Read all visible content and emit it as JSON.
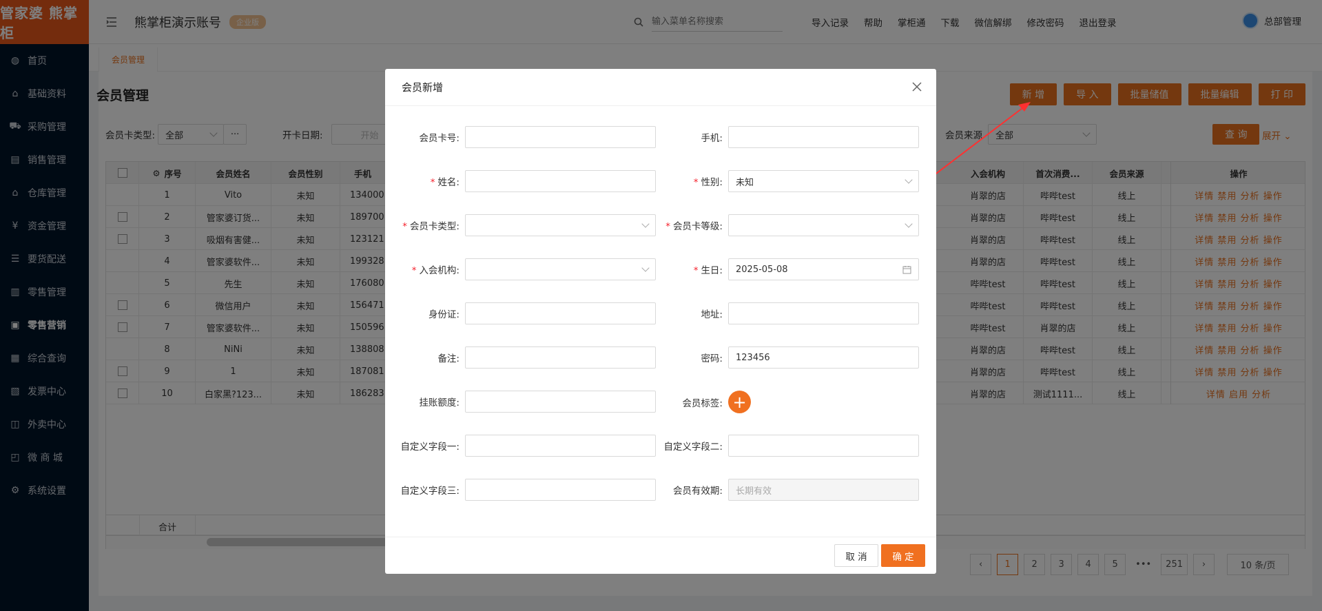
{
  "logo": "管家婆 熊掌柜",
  "sidebar": {
    "items": [
      {
        "label": "首页",
        "icon": "globe-icon"
      },
      {
        "label": "基础资料",
        "icon": "home-icon"
      },
      {
        "label": "采购管理",
        "icon": "cart-icon"
      },
      {
        "label": "销售管理",
        "icon": "chart-icon"
      },
      {
        "label": "仓库管理",
        "icon": "warehouse-icon"
      },
      {
        "label": "资金管理",
        "icon": "money-icon"
      },
      {
        "label": "要货配送",
        "icon": "list-icon"
      },
      {
        "label": "零售管理",
        "icon": "bar-chart-icon"
      },
      {
        "label": "零售营销",
        "icon": "gift-icon"
      },
      {
        "label": "综合查询",
        "icon": "stats-icon"
      },
      {
        "label": "发票中心",
        "icon": "invoice-icon"
      },
      {
        "label": "外卖中心",
        "icon": "delivery-icon"
      },
      {
        "label": "微 商 城",
        "icon": "shop-icon"
      },
      {
        "label": "系统设置",
        "icon": "gear-icon"
      }
    ]
  },
  "header": {
    "account": "熊掌柜演示账号",
    "edition": "企业版",
    "search_placeholder": "输入菜单名称搜索",
    "links": [
      "导入记录",
      "帮助",
      "掌柜通",
      "下载",
      "微信解绑",
      "修改密码",
      "退出登录"
    ],
    "user": "总部管理"
  },
  "tab": "会员管理",
  "page": {
    "title": "会员管理",
    "buttons": [
      "新 增",
      "导 入",
      "批量储值",
      "批量编辑",
      "打 印"
    ],
    "filters": {
      "card_type_label": "会员卡类型:",
      "card_type_value": "全部",
      "more": "···",
      "open_date_label": "开卡日期:",
      "open_date_placeholder": "开始",
      "source_label": "会员来源",
      "source_value": "全部",
      "query": "查 询",
      "expand": "展开"
    }
  },
  "table": {
    "headers": {
      "index": "序号",
      "name": "会员姓名",
      "gender": "会员性别",
      "phone": "手机",
      "org": "入会机构",
      "first": "首次消费...",
      "source": "会员来源",
      "ops": "操作"
    },
    "rows": [
      {
        "idx": "1",
        "name": "Vito",
        "gender": "未知",
        "phone": "134000",
        "org": "肖翠的店",
        "first": "哔哔test",
        "source": "线上",
        "ops": "详情 禁用 分析 操作"
      },
      {
        "idx": "2",
        "name": "管家婆订货...",
        "gender": "未知",
        "phone": "189700",
        "org": "肖翠的店",
        "first": "哔哔test",
        "source": "线上",
        "ops": "详情 禁用 分析 操作"
      },
      {
        "idx": "3",
        "name": "吸烟有害健...",
        "gender": "未知",
        "phone": "123121",
        "org": "肖翠的店",
        "first": "哔哔test",
        "source": "线上",
        "ops": "详情 禁用 分析 操作"
      },
      {
        "idx": "4",
        "name": "管家婆软件...",
        "gender": "未知",
        "phone": "199328",
        "org": "肖翠的店",
        "first": "哔哔test",
        "source": "线上",
        "ops": "详情 禁用 分析 操作"
      },
      {
        "idx": "5",
        "name": "先生",
        "gender": "未知",
        "phone": "176080",
        "org": "哔哔test",
        "first": "哔哔test",
        "source": "线上",
        "ops": "详情 禁用 分析 操作"
      },
      {
        "idx": "6",
        "name": "微信用户",
        "gender": "未知",
        "phone": "156471",
        "org": "哔哔test",
        "first": "哔哔test",
        "source": "线上",
        "ops": "详情 禁用 分析 操作"
      },
      {
        "idx": "7",
        "name": "管家婆软件...",
        "gender": "未知",
        "phone": "150596",
        "org": "哔哔test",
        "first": "肖翠的店",
        "source": "线上",
        "ops": "详情 禁用 分析 操作"
      },
      {
        "idx": "8",
        "name": "NiNi",
        "gender": "未知",
        "phone": "138808",
        "org": "肖翠的店",
        "first": "哔哔test",
        "source": "线上",
        "ops": "详情 禁用 分析 操作"
      },
      {
        "idx": "9",
        "name": "1",
        "gender": "未知",
        "phone": "187081",
        "org": "肖翠的店",
        "first": "哔哔test",
        "source": "线上",
        "ops": "详情 禁用 分析 操作"
      },
      {
        "idx": "10",
        "name": "白家黑?123...",
        "gender": "未知",
        "phone": "186283",
        "org": "肖翠的店",
        "first": "测试1111...",
        "source": "线上",
        "ops": "详情 启用 分析"
      }
    ],
    "total_label": "合计"
  },
  "pager": {
    "pages": [
      "1",
      "2",
      "3",
      "4",
      "5",
      "•••",
      "251"
    ],
    "page_size": "10 条/页"
  },
  "modal": {
    "title": "会员新增",
    "fields": {
      "card_no": {
        "label": "会员卡号:",
        "value": ""
      },
      "phone": {
        "label": "手机:",
        "value": ""
      },
      "name": {
        "label": "姓名:",
        "value": ""
      },
      "gender": {
        "label": "性别:",
        "value": "未知"
      },
      "card_type": {
        "label": "会员卡类型:",
        "value": ""
      },
      "card_level": {
        "label": "会员卡等级:",
        "value": ""
      },
      "org": {
        "label": "入会机构:",
        "value": ""
      },
      "birthday": {
        "label": "生日:",
        "value": "2025-05-08"
      },
      "id_card": {
        "label": "身份证:",
        "value": ""
      },
      "address": {
        "label": "地址:",
        "value": ""
      },
      "remark": {
        "label": "备注:",
        "value": ""
      },
      "password": {
        "label": "密码:",
        "value": "123456"
      },
      "credit": {
        "label": "挂账额度:",
        "value": ""
      },
      "tags": {
        "label": "会员标签:"
      },
      "custom1": {
        "label": "自定义字段一:",
        "value": ""
      },
      "custom2": {
        "label": "自定义字段二:",
        "value": ""
      },
      "custom3": {
        "label": "自定义字段三:",
        "value": ""
      },
      "validity": {
        "label": "会员有效期:",
        "placeholder": "长期有效"
      }
    },
    "cancel": "取 消",
    "ok": "确 定"
  },
  "colors": {
    "accent": "#e8711f",
    "sidebar": "#001529",
    "required": "#f5222d"
  }
}
